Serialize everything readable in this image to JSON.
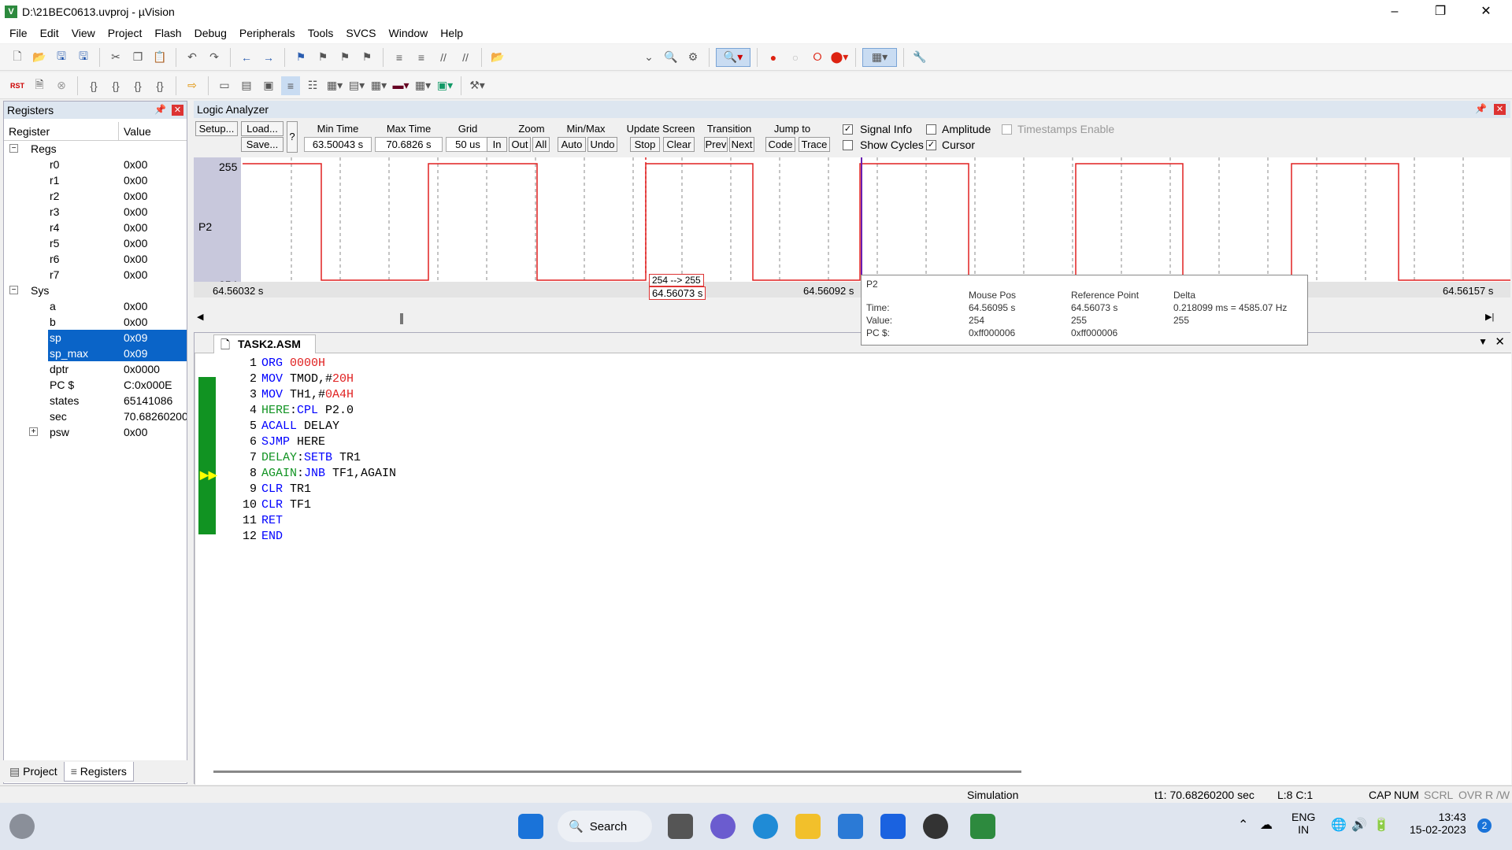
{
  "window": {
    "title": "D:\\21BEC0613.uvproj - µVision",
    "app_icon": "V"
  },
  "menu": [
    "File",
    "Edit",
    "View",
    "Project",
    "Flash",
    "Debug",
    "Peripherals",
    "Tools",
    "SVCS",
    "Window",
    "Help"
  ],
  "registers": {
    "header": "Registers",
    "col_register": "Register",
    "col_value": "Value",
    "groups": {
      "regs": "Regs",
      "sys": "Sys"
    },
    "regs": [
      {
        "name": "r0",
        "value": "0x00"
      },
      {
        "name": "r1",
        "value": "0x00"
      },
      {
        "name": "r2",
        "value": "0x00"
      },
      {
        "name": "r3",
        "value": "0x00"
      },
      {
        "name": "r4",
        "value": "0x00"
      },
      {
        "name": "r5",
        "value": "0x00"
      },
      {
        "name": "r6",
        "value": "0x00"
      },
      {
        "name": "r7",
        "value": "0x00"
      }
    ],
    "sys": [
      {
        "name": "a",
        "value": "0x00"
      },
      {
        "name": "b",
        "value": "0x00"
      },
      {
        "name": "sp",
        "value": "0x09"
      },
      {
        "name": "sp_max",
        "value": "0x09"
      },
      {
        "name": "dptr",
        "value": "0x0000"
      },
      {
        "name": "PC  $",
        "value": "C:0x000E"
      },
      {
        "name": "states",
        "value": "65141086"
      },
      {
        "name": "sec",
        "value": "70.68260200"
      },
      {
        "name": "psw",
        "value": "0x00"
      }
    ],
    "tabs": [
      "Project",
      "Registers"
    ]
  },
  "logic_analyzer": {
    "header": "Logic Analyzer",
    "setup": "Setup...",
    "load": "Load...",
    "save": "Save...",
    "help": "?",
    "min_time_label": "Min Time",
    "min_time": "63.50043 s",
    "max_time_label": "Max Time",
    "max_time": "70.6826 s",
    "grid_label": "Grid",
    "grid": "50 us",
    "zoom_label": "Zoom",
    "zoom_in": "In",
    "zoom_out": "Out",
    "zoom_all": "All",
    "minmax_label": "Min/Max",
    "auto": "Auto",
    "undo": "Undo",
    "update_label": "Update Screen",
    "stop": "Stop",
    "clear": "Clear",
    "transition_label": "Transition",
    "prev": "Prev",
    "next": "Next",
    "jump_label": "Jump to",
    "code": "Code",
    "trace": "Trace",
    "signal_info": "Signal Info",
    "show_cycles": "Show Cycles",
    "amplitude": "Amplitude",
    "cursor": "Cursor",
    "timestamps": "Timestamps Enable",
    "signal_name": "P2",
    "y_high": "255",
    "y_low": "254",
    "t_left": "64.56032 s",
    "t_ref": "64.56073 s",
    "t_mid": "64.56092 s",
    "t_right": "64.56157 s",
    "transition_label_box": "254 --> 255",
    "tooltip": {
      "signal": "P2",
      "col_mouse": "Mouse Pos",
      "col_ref": "Reference Point",
      "col_delta": "Delta",
      "row_time": "Time:",
      "row_value": "Value:",
      "row_pc": "PC $:",
      "mouse_time": "64.56095 s",
      "mouse_value": "254",
      "mouse_pc": "0xff000006",
      "ref_time": "64.56073 s",
      "ref_value": "255",
      "ref_pc": "0xff000006",
      "delta_time": "0.218099 ms = 4585.07 Hz",
      "delta_value": "255"
    },
    "wave_color": "#e02020"
  },
  "editor": {
    "tab": "TASK2.ASM",
    "lines": [
      {
        "n": "1",
        "parts": [
          [
            "kw",
            "ORG "
          ],
          [
            "num",
            "0000H"
          ]
        ]
      },
      {
        "n": "2",
        "parts": [
          [
            "kw",
            "MOV "
          ],
          [
            "plain",
            "TMOD,#"
          ],
          [
            "num",
            "20H"
          ]
        ]
      },
      {
        "n": "3",
        "parts": [
          [
            "kw",
            "MOV "
          ],
          [
            "plain",
            "TH1,#"
          ],
          [
            "num",
            "0A4H"
          ]
        ]
      },
      {
        "n": "4",
        "parts": [
          [
            "lbl",
            "HERE"
          ],
          [
            "plain",
            ":"
          ],
          [
            "kw",
            "CPL "
          ],
          [
            "plain",
            "P2.0"
          ]
        ]
      },
      {
        "n": "5",
        "parts": [
          [
            "kw",
            "ACALL "
          ],
          [
            "plain",
            "DELAY"
          ]
        ]
      },
      {
        "n": "6",
        "parts": [
          [
            "kw",
            "SJMP "
          ],
          [
            "plain",
            "HERE"
          ]
        ]
      },
      {
        "n": "7",
        "parts": [
          [
            "lbl",
            "DELAY"
          ],
          [
            "plain",
            ":"
          ],
          [
            "kw",
            "SETB "
          ],
          [
            "plain",
            "TR1"
          ]
        ]
      },
      {
        "n": "8",
        "parts": [
          [
            "lbl",
            "AGAIN"
          ],
          [
            "plain",
            ":"
          ],
          [
            "kw",
            "JNB "
          ],
          [
            "plain",
            "TF1,AGAIN"
          ]
        ]
      },
      {
        "n": "9",
        "parts": [
          [
            "kw",
            "CLR "
          ],
          [
            "plain",
            "TR1"
          ]
        ]
      },
      {
        "n": "10",
        "parts": [
          [
            "kw",
            "CLR "
          ],
          [
            "plain",
            "TF1"
          ]
        ]
      },
      {
        "n": "11",
        "parts": [
          [
            "kw",
            "RET"
          ]
        ]
      },
      {
        "n": "12",
        "parts": [
          [
            "kw",
            "END"
          ]
        ]
      }
    ]
  },
  "status": {
    "mode": "Simulation",
    "time": "t1: 70.68260200 sec",
    "pos": "L:8 C:1",
    "caps": "CAP",
    "num": "NUM",
    "scrl": "SCRL",
    "ovr": "OVR",
    "rw": "R /W"
  },
  "taskbar": {
    "search": "Search",
    "lang1": "ENG",
    "lang2": "IN",
    "time": "13:43",
    "date": "15-02-2023",
    "badge": "2"
  }
}
